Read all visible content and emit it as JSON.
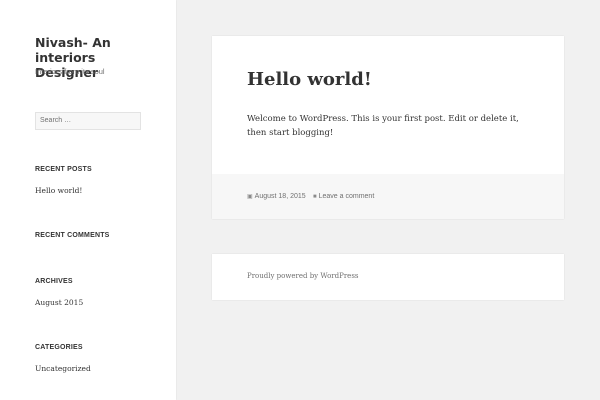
{
  "site": {
    "title": "Nivash- An interiors Designer",
    "description": "Interiors from its soul"
  },
  "search": {
    "placeholder": "Search …"
  },
  "widgets": {
    "recent_posts": {
      "title": "RECENT POSTS",
      "items": [
        "Hello world!"
      ]
    },
    "recent_comments": {
      "title": "RECENT COMMENTS"
    },
    "archives": {
      "title": "ARCHIVES",
      "items": [
        "August 2015"
      ]
    },
    "categories": {
      "title": "CATEGORIES",
      "items": [
        "Uncategorized"
      ]
    }
  },
  "post": {
    "title": "Hello world!",
    "content": "Welcome to WordPress. This is your first post. Edit or delete it, then start blogging!",
    "date": "August 18, 2015",
    "comment_link": "Leave a comment",
    "date_icon": "calendar-icon",
    "comment_icon": "speech-bubble-icon"
  },
  "footer": {
    "powered": "Proudly powered by WordPress"
  }
}
